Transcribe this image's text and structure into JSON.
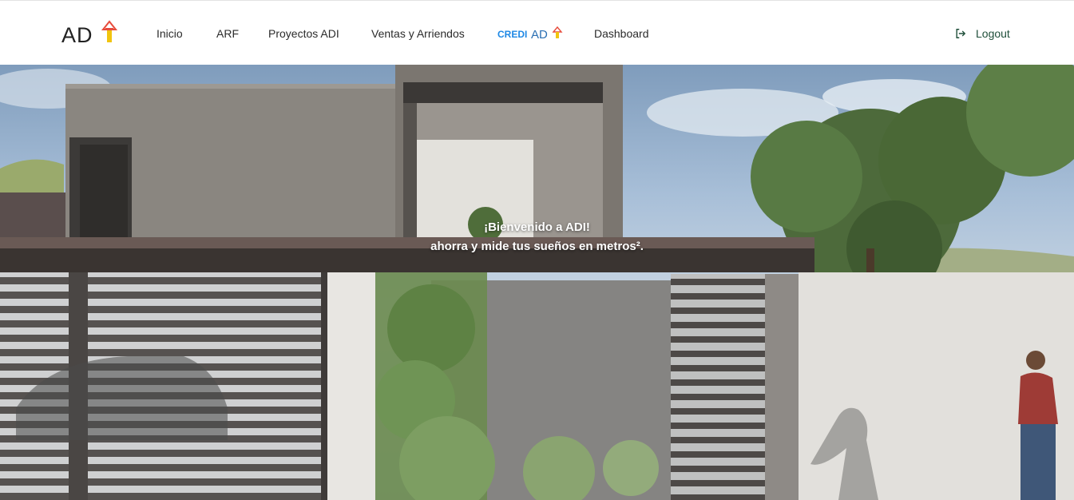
{
  "nav": {
    "logo_text": "AD",
    "items": [
      {
        "label": "Inicio"
      },
      {
        "label": "ARF"
      },
      {
        "label": "Proyectos ADI"
      },
      {
        "label": "Ventas y Arriendos"
      },
      {
        "label": "Dashboard"
      }
    ],
    "credi_logo": {
      "prefix": "CREDI",
      "suffix": "AD"
    },
    "logout_label": "Logout"
  },
  "hero": {
    "title": "¡Bienvenido a ADI!",
    "subtitle": "ahorra y mide tus sueños en metros².",
    "image_icon": "modern-house-facade-image"
  },
  "colors": {
    "logo_accent_red": "#e74c3c",
    "logo_accent_yellow": "#f1c40f",
    "credi_blue": "#1e88e5",
    "logout_green": "#1f4f3a"
  }
}
